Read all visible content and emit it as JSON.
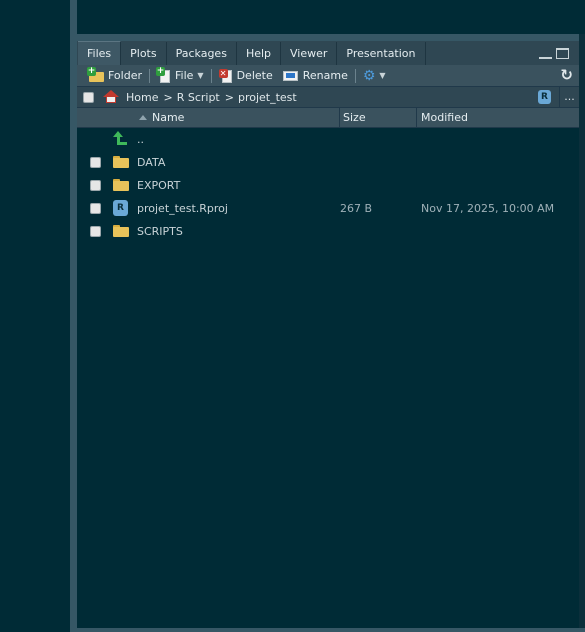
{
  "tabs": [
    {
      "label": "Files",
      "active": true
    },
    {
      "label": "Plots"
    },
    {
      "label": "Packages"
    },
    {
      "label": "Help"
    },
    {
      "label": "Viewer"
    },
    {
      "label": "Presentation"
    }
  ],
  "toolbar": {
    "folder_label": "Folder",
    "file_label": "File",
    "delete_label": "Delete",
    "rename_label": "Rename"
  },
  "breadcrumb": {
    "items": [
      "Home",
      "R Script",
      "projet_test"
    ],
    "separator": ">",
    "r_badge": "R",
    "more": "..."
  },
  "columns": {
    "name": "Name",
    "size": "Size",
    "modified": "Modified"
  },
  "files": [
    {
      "name": "..",
      "type": "parent-dir",
      "icon": "up-arrow-icon",
      "size": "",
      "modified": ""
    },
    {
      "name": "DATA",
      "type": "folder",
      "icon": "folder-icon",
      "size": "",
      "modified": ""
    },
    {
      "name": "EXPORT",
      "type": "folder",
      "icon": "folder-icon",
      "size": "",
      "modified": ""
    },
    {
      "name": "projet_test.Rproj",
      "type": "rproj",
      "icon": "rproj-icon",
      "size": "267 B",
      "modified": "Nov 17, 2025, 10:00 AM"
    },
    {
      "name": "SCRIPTS",
      "type": "folder",
      "icon": "folder-icon",
      "size": "",
      "modified": ""
    }
  ],
  "colors": {
    "background": "#002b36",
    "tabbar": "#2f4753",
    "toolbar": "#3a525e",
    "folder": "#e8c35a",
    "accent_green": "#3fb85a",
    "r_blue": "#6aa8d6"
  }
}
